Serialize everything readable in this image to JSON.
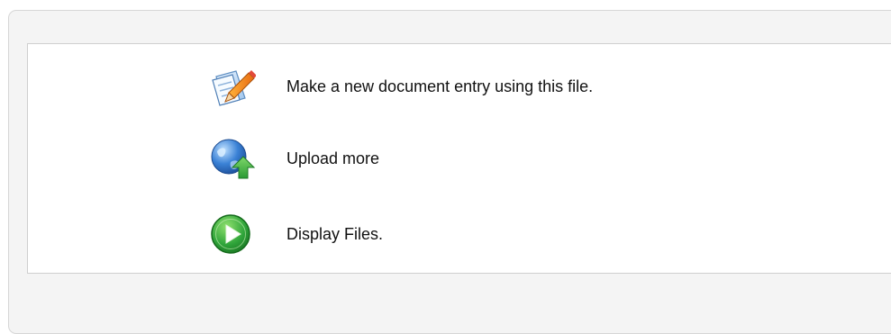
{
  "actions": [
    {
      "label": "Make a new document entry using this file.",
      "icon": "edit-document-icon"
    },
    {
      "label": "Upload more",
      "icon": "globe-upload-icon"
    },
    {
      "label": "Display Files.",
      "icon": "play-icon"
    }
  ],
  "colors": {
    "panel_background": "#f4f4f4",
    "panel_border": "#d6d6d6",
    "box_border": "#cfcfcf",
    "play_green": "#2fa43a",
    "upload_arrow_green": "#3fb34a",
    "globe_blue": "#2f6fc4"
  }
}
